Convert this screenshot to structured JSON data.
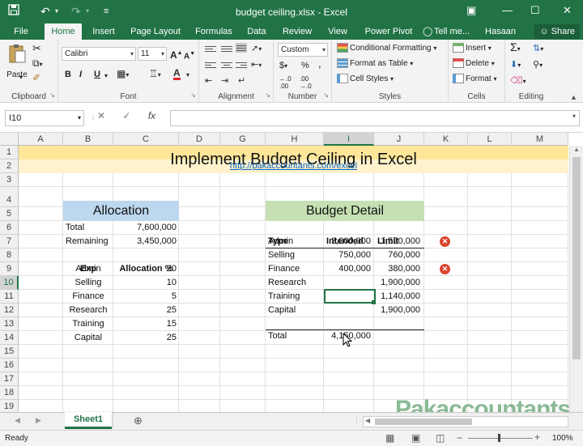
{
  "window": {
    "title": "budget ceiling.xlsx - Excel",
    "save_icon": "save-icon",
    "undo_icon": "undo-icon",
    "redo_icon": "redo-icon"
  },
  "tabs": [
    {
      "label": "File"
    },
    {
      "label": "Home",
      "active": true
    },
    {
      "label": "Insert"
    },
    {
      "label": "Page Layout"
    },
    {
      "label": "Formulas"
    },
    {
      "label": "Data"
    },
    {
      "label": "Review"
    },
    {
      "label": "View"
    },
    {
      "label": "Power Pivot"
    },
    {
      "label": "Tell me..."
    },
    {
      "label": "Hasaan Fa..."
    }
  ],
  "share_label": "Share",
  "ribbon": {
    "clipboard": {
      "label": "Clipboard",
      "paste": "Paste"
    },
    "font": {
      "label": "Font",
      "name": "Calibri",
      "size": "11",
      "bold": "B",
      "italic": "I",
      "underline": "U",
      "grow": "A",
      "shrink": "A"
    },
    "alignment": {
      "label": "Alignment"
    },
    "number": {
      "label": "Number",
      "format": "Custom",
      "currency": "$",
      "percent": "%",
      "comma": ","
    },
    "styles": {
      "label": "Styles",
      "conditional": "Conditional Formatting",
      "table": "Format as Table",
      "cell_styles": "Cell Styles"
    },
    "cells": {
      "label": "Cells",
      "insert": "Insert",
      "delete": "Delete",
      "format": "Format"
    },
    "editing": {
      "label": "Editing"
    }
  },
  "formula_bar": {
    "name_box": "I10",
    "fx": "fx",
    "formula": ""
  },
  "columns": [
    "A",
    "B",
    "C",
    "D",
    "G",
    "H",
    "I",
    "J",
    "K",
    "L",
    "M"
  ],
  "rows": [
    "1",
    "2",
    "3",
    "4",
    "5",
    "6",
    "7",
    "8",
    "9",
    "10",
    "11",
    "12",
    "13",
    "14",
    "15",
    "16",
    "17",
    "18",
    "19"
  ],
  "sheet": {
    "title": "Implement Budget Ceiling in Excel",
    "url": "http://pakaccountants.com/excel",
    "allocation": {
      "heading": "Allocation",
      "total_label": "Total",
      "total_value": "7,600,000",
      "remaining_label": "Remaining",
      "remaining_value": "3,450,000",
      "exp_header": "Exp",
      "pct_header": "Allocation %",
      "rows": [
        {
          "exp": "Admin",
          "pct": "20"
        },
        {
          "exp": "Selling",
          "pct": "10"
        },
        {
          "exp": "Finance",
          "pct": "5"
        },
        {
          "exp": "Research",
          "pct": "25"
        },
        {
          "exp": "Training",
          "pct": "15"
        },
        {
          "exp": "Capital",
          "pct": "25"
        }
      ]
    },
    "budget": {
      "heading": "Budget Detail",
      "type_header": "Type",
      "intended_header": "Intended",
      "limit_header": "Limit",
      "rows": [
        {
          "type": "Admin",
          "intended": "3,000,000",
          "limit": "1,520,000",
          "flag": true
        },
        {
          "type": "Selling",
          "intended": "750,000",
          "limit": "760,000",
          "flag": false
        },
        {
          "type": "Finance",
          "intended": "400,000",
          "limit": "380,000",
          "flag": true
        },
        {
          "type": "Research",
          "intended": "",
          "limit": "1,900,000",
          "flag": false
        },
        {
          "type": "Training",
          "intended": "",
          "limit": "1,140,000",
          "flag": false
        },
        {
          "type": "Capital",
          "intended": "",
          "limit": "1,900,000",
          "flag": false
        }
      ],
      "total_label": "Total",
      "total_value": "4,150,000"
    }
  },
  "sheet_tab": "Sheet1",
  "status": "Ready",
  "zoom": "100%",
  "watermark": "Pakaccountants.com",
  "colors": {
    "excel_green": "#217346",
    "allocation_fill": "#bdd7ee",
    "budget_fill": "#c6e0b4",
    "title_fill": "#ffe699",
    "error_red": "#d9442c",
    "link": "#0563c1"
  }
}
